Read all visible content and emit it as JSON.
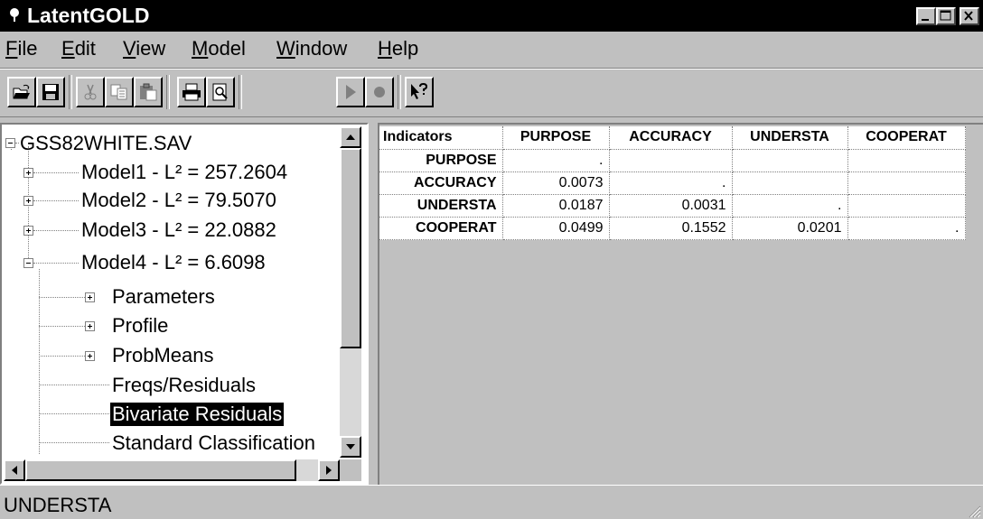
{
  "window": {
    "title": "LatentGOLD",
    "buttons": [
      "minimize",
      "maximize",
      "close"
    ]
  },
  "menu": {
    "items": [
      {
        "label": "File",
        "key": "F",
        "rest": "ile"
      },
      {
        "label": "Edit",
        "key": "E",
        "rest": "dit"
      },
      {
        "label": "View",
        "key": "V",
        "rest": "iew"
      },
      {
        "label": "Model",
        "key": "M",
        "rest": "odel"
      },
      {
        "label": "Window",
        "key": "W",
        "rest": "indow"
      },
      {
        "label": "Help",
        "key": "H",
        "rest": "elp"
      }
    ]
  },
  "toolbar": {
    "buttons": [
      "open-icon",
      "save-icon",
      "cut-icon",
      "copy-icon",
      "paste-icon",
      "print-icon",
      "print-preview-icon",
      "run-icon",
      "stop-icon",
      "context-help-icon"
    ]
  },
  "tree": {
    "root": "GSS82WHITE.SAV",
    "models": [
      {
        "label": "Model1 - L² = 257.2604"
      },
      {
        "label": "Model2 - L² = 79.5070"
      },
      {
        "label": "Model3 - L² = 22.0882"
      },
      {
        "label": "Model4 - L² = 6.6098"
      }
    ],
    "children": [
      {
        "label": "Parameters"
      },
      {
        "label": "Profile"
      },
      {
        "label": "ProbMeans"
      },
      {
        "label": "Freqs/Residuals"
      },
      {
        "label": "Bivariate Residuals"
      },
      {
        "label": "Standard Classification"
      }
    ]
  },
  "table": {
    "corner": "Indicators",
    "columns": [
      "PURPOSE",
      "ACCURACY",
      "UNDERSTA",
      "COOPERAT"
    ],
    "rows": [
      {
        "label": "PURPOSE",
        "cells": [
          ".",
          "",
          "",
          ""
        ]
      },
      {
        "label": "ACCURACY",
        "cells": [
          "0.0073",
          ".",
          "",
          ""
        ]
      },
      {
        "label": "UNDERSTA",
        "cells": [
          "0.0187",
          "0.0031",
          ".",
          ""
        ]
      },
      {
        "label": "COOPERAT",
        "cells": [
          "0.0499",
          "0.1552",
          "0.0201",
          "."
        ]
      }
    ]
  },
  "status": {
    "text": "UNDERSTA"
  },
  "colors": {
    "face": "#c0c0c0",
    "titlebar": "#000000",
    "selection": "#000000"
  }
}
